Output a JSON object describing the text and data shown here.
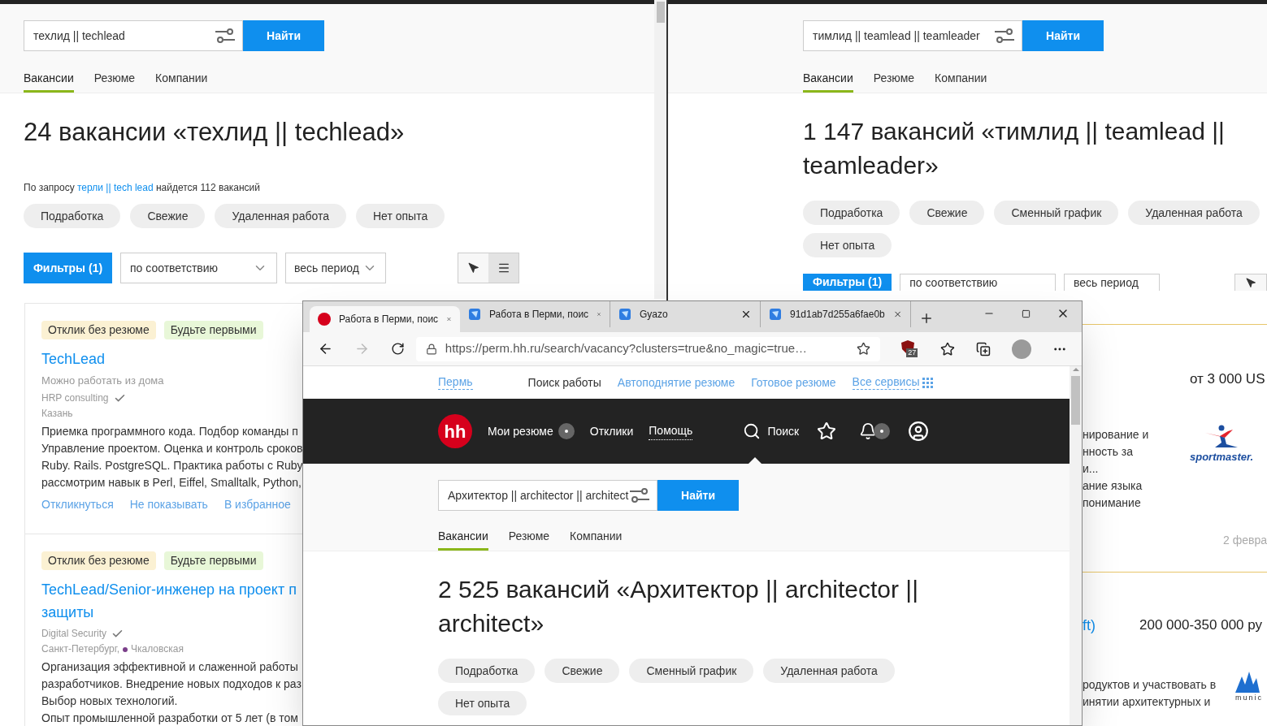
{
  "left_window": {
    "search": {
      "value": "техлид || techlead",
      "button": "Найти"
    },
    "tabs": [
      {
        "label": "Вакансии",
        "selected": true
      },
      {
        "label": "Резюме",
        "selected": false
      },
      {
        "label": "Компании",
        "selected": false
      }
    ],
    "heading": "24 вакансии «техлид || techlead»",
    "hint": {
      "before": "По запросу",
      "link": "терли || tech lead",
      "after": "найдется 112 вакансий"
    },
    "chips": [
      "Подработка",
      "Свежие",
      "Удаленная работа",
      "Нет опыта"
    ],
    "filters_button": "Фильтры (1)",
    "sort": "по соответствию",
    "period": "весь период",
    "view_toggle": [
      {
        "kind": "map",
        "selected": false
      },
      {
        "kind": "list",
        "selected": true
      }
    ],
    "cards": [
      {
        "badges": [
          {
            "kind": "no_resume",
            "label": "Отклик без резюме"
          },
          {
            "kind": "first",
            "label": "Будьте первыми"
          }
        ],
        "title": [
          "TechLead"
        ],
        "note": "Можно работать из дома",
        "company": "HRP consulting",
        "location": "Казань",
        "lines": [
          "Приемка программного кода. Подбор команды п",
          "Управление проектом. Оценка и контроль сроков",
          "Ruby. Rails. PostgreSQL. Практика работы с Ruby",
          "рассмотрим навык в Perl, Eiffel, Smalltalk, Python,"
        ],
        "actions": [
          "Откликнуться",
          "Не показывать",
          "В избранное"
        ]
      },
      {
        "badges": [
          {
            "kind": "no_resume",
            "label": "Отклик без резюме"
          },
          {
            "kind": "first",
            "label": "Будьте первыми"
          }
        ],
        "title": [
          "TechLead/Senior-инженер на проект п",
          "защиты"
        ],
        "company": "Digital Security",
        "location": "Санкт-Петербург,",
        "metro": {
          "name": "Чкаловская",
          "color": "#7b3f8a"
        },
        "lines": [
          "Организация эффективной и слаженной работы",
          "разработчиков. Внедрение новых подходов к раз",
          "Выбор новых технологий.",
          "Опыт промышленной разработки от 5 лет (в том"
        ]
      }
    ]
  },
  "right_window": {
    "search": {
      "value": "тимлид || teamlead || teamleader",
      "button": "Найти"
    },
    "tabs": [
      {
        "label": "Вакансии",
        "selected": true
      },
      {
        "label": "Резюме",
        "selected": false
      },
      {
        "label": "Компании",
        "selected": false
      }
    ],
    "heading": "1 147 вакансий «тимлид || teamlead || teamleader»",
    "chips": [
      "Подработка",
      "Свежие",
      "Сменный график",
      "Удаленная работа",
      "Нет опыта"
    ],
    "filters_button": "Фильтры (1)",
    "sort": "по соответствию",
    "period": "весь период",
    "cards": [
      {
        "salary": "от 3 000 US",
        "lines": [
          "нирование и",
          "нность за",
          "и...",
          "ание языка",
          "понимание"
        ],
        "logo": {
          "kind": "sportmaster",
          "text": "sportmaster."
        },
        "date": "2 февра"
      },
      {
        "title": "ft)",
        "salary": "200 000-350 000 ру",
        "lines": [
          "родуктов и участвовать в",
          "инятии архитектурных и"
        ],
        "logo": {
          "kind": "munic",
          "text": "munic"
        }
      }
    ]
  },
  "browser": {
    "tabs": [
      {
        "kind": "hh",
        "title": "Работа в Перми, поис",
        "selected": true
      },
      {
        "kind": "gyazo",
        "title": "Работа в Перми, поис",
        "selected": false
      },
      {
        "kind": "gyazo",
        "title": "Gyazo",
        "selected": false
      },
      {
        "kind": "gyazo",
        "title": "91d1ab7d255a6fae0b",
        "selected": false
      }
    ],
    "forward_disabled": true,
    "address": "https://perm.hh.ru/search/vacancy?clusters=true&no_magic=true…",
    "extension_badge": "27",
    "site_nav": [
      {
        "kind": "city",
        "label": "Пермь"
      },
      {
        "kind": "plain",
        "label": "Поиск работы"
      },
      {
        "kind": "link",
        "label": "Автоподнятие резюме"
      },
      {
        "kind": "link",
        "label": "Готовое резюме"
      },
      {
        "kind": "services",
        "label": "Все сервисы"
      }
    ],
    "logo": "hh",
    "header_nav": [
      {
        "kind": "resumes",
        "label": "Мои резюме"
      },
      {
        "kind": "plain",
        "label": "Отклики"
      },
      {
        "kind": "help",
        "label": "Помощь"
      }
    ],
    "search_label": "Поиск",
    "page": {
      "search": {
        "value": "Архитектор || architector || architect",
        "button": "Найти"
      },
      "tabs": [
        {
          "label": "Вакансии",
          "selected": true
        },
        {
          "label": "Резюме",
          "selected": false
        },
        {
          "label": "Компании",
          "selected": false
        }
      ],
      "heading": "2 525 вакансий «Архитектор || architector || architect»",
      "chips": [
        "Подработка",
        "Свежие",
        "Сменный график",
        "Удаленная работа",
        "Нет опыта"
      ]
    }
  }
}
